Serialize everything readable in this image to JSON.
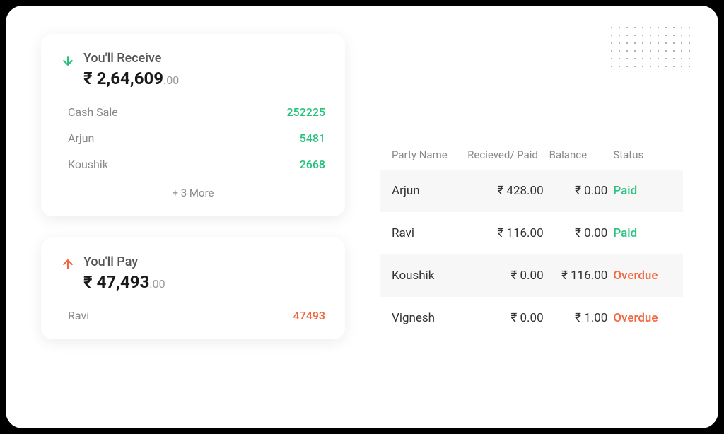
{
  "receive": {
    "title": "You'll Receive",
    "currency": "₹",
    "amount": "2,64,609",
    "decimal": ".00",
    "items": [
      {
        "name": "Cash Sale",
        "value": "252225"
      },
      {
        "name": "Arjun",
        "value": "5481"
      },
      {
        "name": "Koushik",
        "value": "2668"
      }
    ],
    "more": "+ 3 More"
  },
  "pay": {
    "title": "You'll Pay",
    "currency": "₹",
    "amount": "47,493",
    "decimal": ".00",
    "items": [
      {
        "name": "Ravi",
        "value": "47493"
      }
    ]
  },
  "table": {
    "headers": {
      "party": "Party Name",
      "received": "Recieved/ Paid",
      "balance": "Balance",
      "status": "Status"
    },
    "rows": [
      {
        "party": "Arjun",
        "received": "₹ 428.00",
        "balance": "₹ 0.00",
        "status": "Paid",
        "statusType": "paid"
      },
      {
        "party": "Ravi",
        "received": "₹ 116.00",
        "balance": "₹ 0.00",
        "status": "Paid",
        "statusType": "paid"
      },
      {
        "party": "Koushik",
        "received": "₹ 0.00",
        "balance": "₹ 116.00",
        "status": "Overdue",
        "statusType": "overdue"
      },
      {
        "party": "Vignesh",
        "received": "₹ 0.00",
        "balance": "₹ 1.00",
        "status": "Overdue",
        "statusType": "overdue"
      }
    ]
  }
}
